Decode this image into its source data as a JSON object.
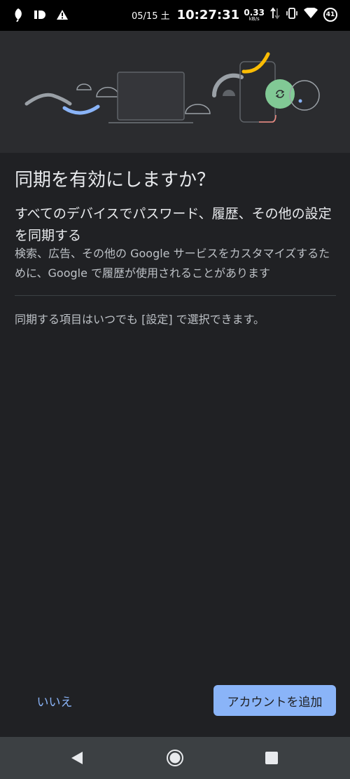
{
  "status_bar": {
    "date": "05/15 土",
    "time": "10:27:31",
    "net_speed": "0.33",
    "net_unit": "kB/s",
    "battery": "41"
  },
  "dialog": {
    "title": "同期を有効にしますか？",
    "subtitle": "すべてのデバイスでパスワード、履歴、その他の設定を同期する",
    "description": "検索、広告、その他の Google サービスをカスタマイズするために、Google で履歴が使用されることがあります",
    "note": "同期する項目はいつでも [設定] で選択できます。"
  },
  "buttons": {
    "no_label": "いいえ",
    "add_account_label": "アカウントを追加"
  },
  "icons": {
    "notification_1": "leaf-icon",
    "notification_2": "id-icon",
    "notification_3": "warning-icon",
    "sync": "sync-icon",
    "nav_back": "back-triangle-icon",
    "nav_home": "home-circle-icon",
    "nav_recents": "recents-square-icon"
  },
  "colors": {
    "background": "#202124",
    "accent": "#8ab4f8",
    "illustration_green": "#81c995",
    "illustration_yellow": "#fbbc04"
  }
}
